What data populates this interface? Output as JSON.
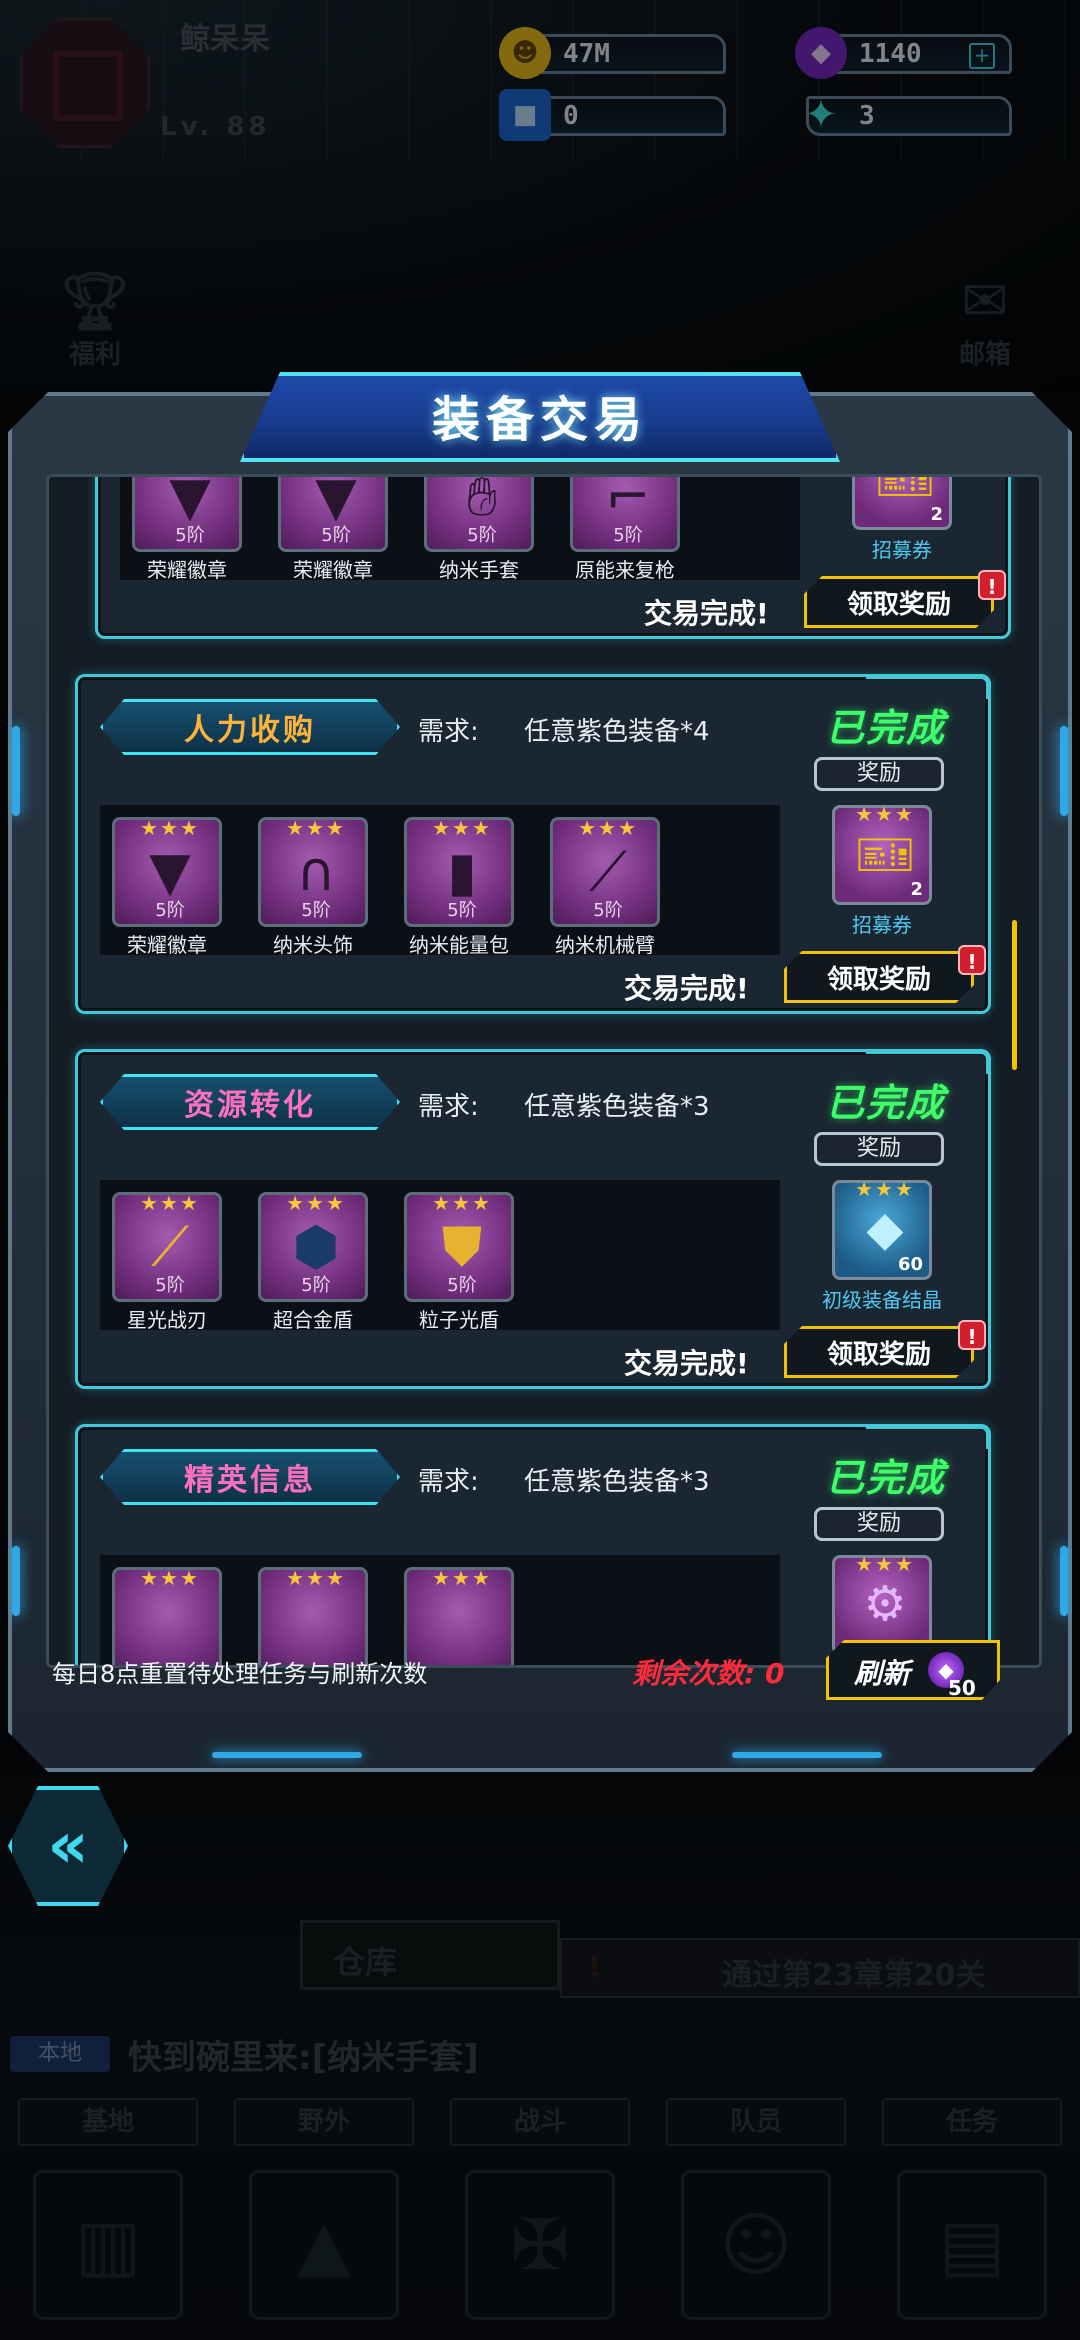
{
  "player": {
    "name": "鲸呆呆",
    "level": "Lv. 88"
  },
  "resources": [
    {
      "icon": "gold-coin-icon",
      "value": "47M"
    },
    {
      "icon": "purple-gem-icon",
      "value": "1140"
    },
    {
      "icon": "blue-cube-icon",
      "value": "0"
    },
    {
      "icon": "cyan-star-icon",
      "value": "3"
    }
  ],
  "side_buttons": {
    "welfare": "福利",
    "mail": "邮箱"
  },
  "title": "装备交易",
  "partial_card": {
    "items": [
      {
        "tier": "5阶",
        "name": "荣耀徽章"
      },
      {
        "tier": "5阶",
        "name": "荣耀徽章"
      },
      {
        "tier": "5阶",
        "name": "纳米手套"
      },
      {
        "tier": "5阶",
        "name": "原能来复枪"
      }
    ],
    "reward": {
      "qty": "2",
      "name": "招募券"
    },
    "complete_text": "交易完成!",
    "claim_label": "领取奖励"
  },
  "cards": [
    {
      "tag": "人力收购",
      "req_label": "需求:",
      "req_value": "任意紫色装备*4",
      "status": "已完成",
      "reward_label": "奖励",
      "items": [
        {
          "tier": "5阶",
          "name": "荣耀徽章"
        },
        {
          "tier": "5阶",
          "name": "纳米头饰"
        },
        {
          "tier": "5阶",
          "name": "纳米能量包"
        },
        {
          "tier": "5阶",
          "name": "纳米机械臂"
        }
      ],
      "reward": {
        "qty": "2",
        "name": "招募券"
      },
      "complete_text": "交易完成!",
      "claim_label": "领取奖励"
    },
    {
      "tag": "资源转化",
      "req_label": "需求:",
      "req_value": "任意紫色装备*3",
      "status": "已完成",
      "reward_label": "奖励",
      "items": [
        {
          "tier": "5阶",
          "name": "星光战刃"
        },
        {
          "tier": "5阶",
          "name": "超合金盾"
        },
        {
          "tier": "5阶",
          "name": "粒子光盾"
        }
      ],
      "reward": {
        "qty": "60",
        "name": "初级装备结晶"
      },
      "complete_text": "交易完成!",
      "claim_label": "领取奖励"
    },
    {
      "tag": "精英信息",
      "req_label": "需求:",
      "req_value": "任意紫色装备*3",
      "status": "已完成",
      "reward_label": "奖励"
    }
  ],
  "footer": {
    "note": "每日8点重置待处理任务与刷新次数",
    "remaining": "剩余次数: 0",
    "refresh_label": "刷新",
    "refresh_cost": "50"
  },
  "background": {
    "warehouse": "仓库",
    "quest": "通过第23章第20关",
    "chat_tag": "本地",
    "chat_text": "快到碗里来:[纳米手套]",
    "tabs": [
      "基地",
      "野外",
      "战斗",
      "队员",
      "任务"
    ]
  },
  "colors": {
    "accent": "#42c8d8",
    "done": "#3dff6a",
    "warning": "#ff2a3a",
    "button_border": "#f2c400"
  }
}
